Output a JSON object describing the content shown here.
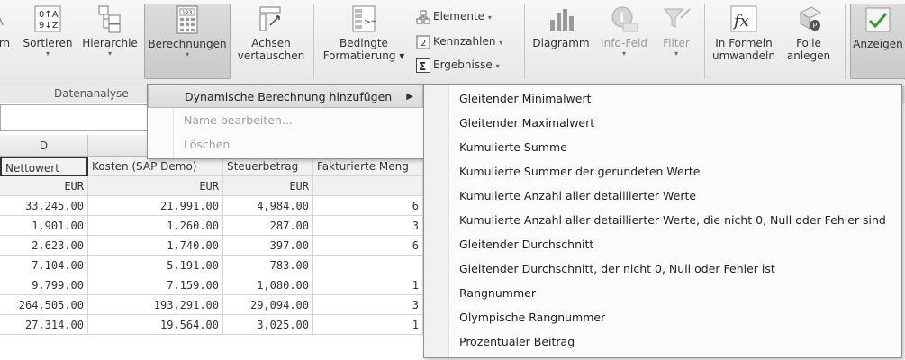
{
  "ribbon": {
    "items": [
      {
        "label": "rn",
        "icon": "cut-off-icon"
      },
      {
        "label": "Sortieren",
        "icon": "sort-icon"
      },
      {
        "label": "Hierarchie",
        "icon": "hierarchy-icon"
      },
      {
        "label": "Berechnungen",
        "icon": "calculator-icon"
      },
      {
        "label": "Achsen vertauschen",
        "line1": "Achsen",
        "line2": "vertauschen",
        "icon": "swap-axes-icon"
      },
      {
        "label": "Bedingte Formatierung",
        "line1": "Bedingte",
        "line2": "Formatierung",
        "icon": "conditional-format-icon"
      },
      {
        "label": "Elemente",
        "icon": "elements-icon"
      },
      {
        "label": "Kennzahlen",
        "icon": "measures-icon"
      },
      {
        "label": "Ergebnisse",
        "icon": "sum-icon"
      },
      {
        "label": "Diagramm",
        "icon": "chart-icon"
      },
      {
        "label": "Info-Feld",
        "icon": "info-icon"
      },
      {
        "label": "Filter",
        "icon": "filter-icon"
      },
      {
        "label": "In Formeln umwandeln",
        "line1": "In Formeln",
        "line2": "umwandeln",
        "icon": "formula-icon"
      },
      {
        "label": "Folie anlegen",
        "line1": "Folie",
        "line2": "anlegen",
        "icon": "slide-icon"
      },
      {
        "label": "Anzeigen",
        "icon": "display-icon"
      }
    ],
    "group_label": "Datenanalyse",
    "colors": {
      "accent": "#dcdcdc",
      "disabled": "#9a9a9a"
    }
  },
  "grid": {
    "column_letter": "D",
    "headers": [
      "Nettowert",
      "Kosten (SAP Demo)",
      "Steuerbetrag",
      "Fakturierte Meng"
    ],
    "units": [
      "EUR",
      "EUR",
      "EUR",
      ""
    ],
    "rows": [
      [
        "33,245.00",
        "21,991.00",
        "4,984.00",
        "6"
      ],
      [
        "1,901.00",
        "1,260.00",
        "287.00",
        "3"
      ],
      [
        "2,623.00",
        "1,740.00",
        "397.00",
        "6"
      ],
      [
        "7,104.00",
        "5,191.00",
        "783.00",
        ""
      ],
      [
        "9,799.00",
        "7,159.00",
        "1,080.00",
        "1"
      ],
      [
        "264,505.00",
        "193,291.00",
        "29,094.00",
        "3"
      ],
      [
        "27,314.00",
        "19,564.00",
        "3,025.00",
        "1"
      ]
    ]
  },
  "menu1": {
    "items": [
      {
        "label": "Dynamische Berechnung hinzufügen",
        "state": "highlighted",
        "arrow": "▶"
      },
      {
        "label": "Name bearbeiten...",
        "state": "disabled"
      },
      {
        "label": "Löschen",
        "state": "disabled"
      }
    ]
  },
  "menu2": {
    "items": [
      "Gleitender Minimalwert",
      "Gleitender Maximalwert",
      "Kumulierte Summe",
      "Kumulierte Summer der gerundeten Werte",
      "Kumulierte Anzahl aller detaillierter Werte",
      "Kumulierte Anzahl aller detaillierter Werte, die nicht 0, Null oder Fehler sind",
      "Gleitender Durchschnitt",
      "Gleitender Durchschnitt, der nicht 0, Null oder Fehler ist",
      "Rangnummer",
      "Olympische Rangnummer",
      "Prozentualer Beitrag"
    ]
  }
}
